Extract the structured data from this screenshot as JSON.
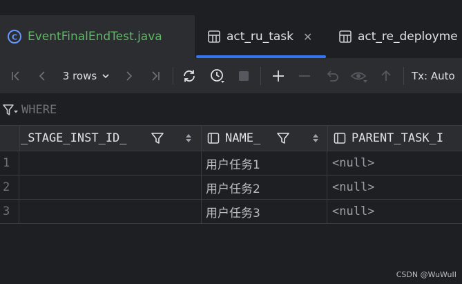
{
  "tabs": [
    {
      "label": "EventFinalEndTest.java",
      "icon": "java-class-icon"
    },
    {
      "label": "act_ru_task",
      "icon": "table-icon",
      "active": true
    },
    {
      "label": "act_re_deployme",
      "icon": "table-icon"
    }
  ],
  "toolbar": {
    "rows_label": "3 rows",
    "tx_label": "Tx: Auto"
  },
  "filter": {
    "where_placeholder": "WHERE"
  },
  "columns": [
    "_STAGE_INST_ID_",
    "NAME_",
    "PARENT_TASK_I"
  ],
  "rows": [
    {
      "num": "1",
      "stage_inst_id": "",
      "name": "用户任务1",
      "parent_task_id": "<null>"
    },
    {
      "num": "2",
      "stage_inst_id": "",
      "name": "用户任务2",
      "parent_task_id": "<null>"
    },
    {
      "num": "3",
      "stage_inst_id": "",
      "name": "用户任务3",
      "parent_task_id": "<null>"
    }
  ],
  "watermark": "CSDN @WuWuII",
  "colors": {
    "accent": "#3574f0",
    "java_text": "#5fb865",
    "background": "#1e1f22",
    "panel": "#2b2d30"
  }
}
